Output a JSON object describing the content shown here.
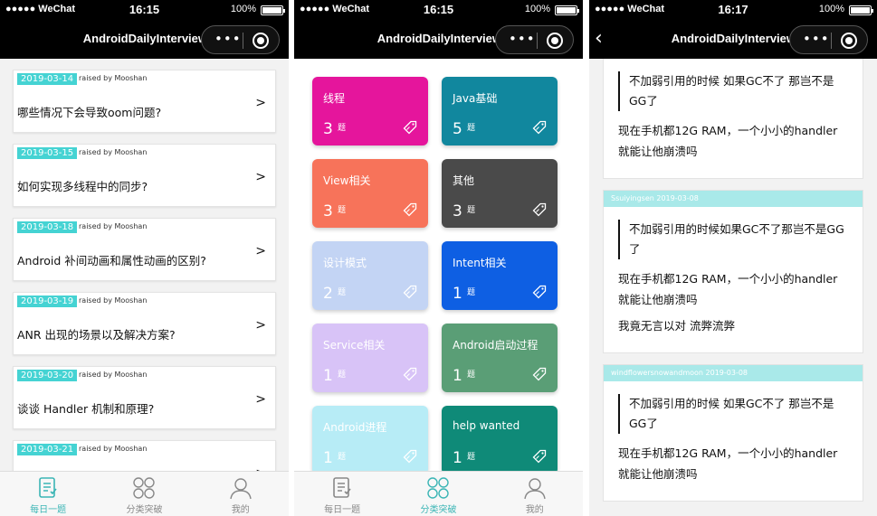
{
  "status": {
    "carrier": "●●●●● WeChat",
    "battery": "100%"
  },
  "screens": [
    {
      "time": "16:15",
      "title": "AndroidDailyInterview",
      "questions": [
        {
          "date": "2019-03-14",
          "raised": "raised by Mooshan",
          "text": "哪些情况下会导致oom问题?"
        },
        {
          "date": "2019-03-15",
          "raised": "raised by Mooshan",
          "text": "如何实现多线程中的同步?"
        },
        {
          "date": "2019-03-18",
          "raised": "raised by Mooshan",
          "text": "Android 补间动画和属性动画的区别?"
        },
        {
          "date": "2019-03-19",
          "raised": "raised by Mooshan",
          "text": "ANR 出现的场景以及解决方案?"
        },
        {
          "date": "2019-03-20",
          "raised": "raised by Mooshan",
          "text": "谈谈 Handler 机制和原理?"
        },
        {
          "date": "2019-03-21",
          "raised": "raised by Mooshan",
          "text": ""
        }
      ]
    },
    {
      "time": "16:15",
      "title": "AndroidDailyInterview",
      "categories": [
        {
          "name": "线程",
          "count": "3",
          "color": "#e5159c"
        },
        {
          "name": "Java基础",
          "count": "5",
          "color": "#11879e"
        },
        {
          "name": "View相关",
          "count": "3",
          "color": "#f7735a"
        },
        {
          "name": "其他",
          "count": "3",
          "color": "#4a4a4a"
        },
        {
          "name": "设计模式",
          "count": "2",
          "color": "#c3d4f4"
        },
        {
          "name": "Intent相关",
          "count": "1",
          "color": "#0e5fe3"
        },
        {
          "name": "Service相关",
          "count": "1",
          "color": "#d8c3f7"
        },
        {
          "name": "Android启动过程",
          "count": "1",
          "color": "#5a9e76"
        },
        {
          "name": "Android进程",
          "count": "1",
          "color": "#b7ecf6"
        },
        {
          "name": "help wanted",
          "count": "1",
          "color": "#0f8a78"
        }
      ],
      "count_unit": "题"
    },
    {
      "time": "16:17",
      "title": "AndroidDailyInterview",
      "comments": [
        {
          "head": "",
          "quote": "不加弱引用的时候 如果GC不了 那岂不是GG了",
          "paras": [
            "现在手机都12G RAM，一个小小的handler就能让他崩溃吗"
          ]
        },
        {
          "head": "Ssuiyingsen 2019-03-08",
          "quote": "不加弱引用的时候如果GC不了那岂不是GG了",
          "paras": [
            "现在手机都12G RAM，一个小小的handler就能让他崩溃吗",
            "我竟无言以对 流弊流弊"
          ]
        },
        {
          "head": "windflowersnowandmoon 2019-03-08",
          "quote": "不加弱引用的时候 如果GC不了 那岂不是GG了",
          "paras": [
            "现在手机都12G RAM，一个小小的handler就能让他崩溃吗"
          ]
        }
      ]
    }
  ],
  "tabs": [
    {
      "label": "每日一题",
      "icon": "daily-icon"
    },
    {
      "label": "分类突破",
      "icon": "category-icon"
    },
    {
      "label": "我的",
      "icon": "profile-icon"
    }
  ],
  "accent": "#3bb5b5"
}
